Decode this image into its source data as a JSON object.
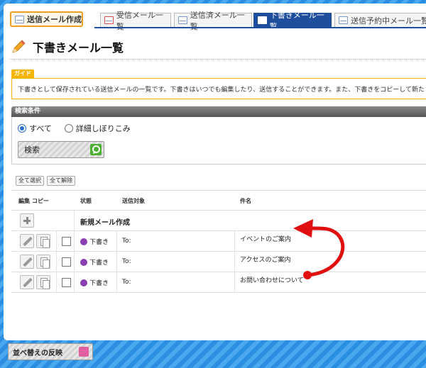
{
  "compose_button": "送信メール作成",
  "tabs": [
    {
      "label": "受信メール一覧",
      "active": false
    },
    {
      "label": "送信済メール一覧",
      "active": false
    },
    {
      "label": "下書きメール一覧",
      "active": true
    },
    {
      "label": "送信予約中メール一覧",
      "active": false
    }
  ],
  "page_title": "下書きメール一覧",
  "guide": {
    "tag": "ガイド",
    "text": "下書きとして保存されている送信メールの一覧です。下書きはいつでも編集したり、送信することができます。また、下書きをコピーして新た"
  },
  "search": {
    "header": "検索条件",
    "radio_all": "すべて",
    "radio_detail": "詳細しぼりこみ",
    "button": "検索"
  },
  "select_all": "全て選択",
  "deselect_all": "全て解除",
  "columns": {
    "edit": "編集",
    "copy": "コピー",
    "status": "状態",
    "target": "送信対象",
    "subject": "件名"
  },
  "new_mail": "新規メール作成",
  "rows": [
    {
      "status": "下書き",
      "to": "To:",
      "subject": "イベントのご案内"
    },
    {
      "status": "下書き",
      "to": "To:",
      "subject": "アクセスのご案内"
    },
    {
      "status": "下書き",
      "to": "To:",
      "subject": "お問い合わせについて"
    }
  ],
  "sort_button": "並べ替えの反映",
  "colors": {
    "accent": "#1f4e9c",
    "guide": "#f5b400",
    "arrow": "#e01010"
  },
  "icons": [
    "pencil-icon",
    "copy-icon",
    "search-icon",
    "plus-icon",
    "envelope-icon",
    "sort-icon"
  ]
}
